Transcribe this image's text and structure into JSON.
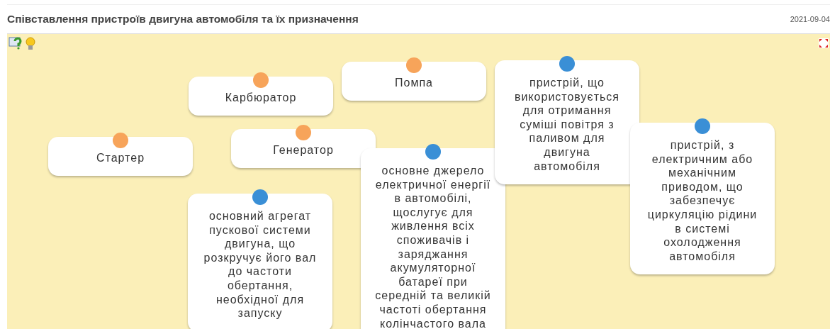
{
  "header": {
    "title": "Співставлення пристроїв двигуна автомобіля та їх призначення",
    "date": "2021-09-04"
  },
  "cards": [
    {
      "kind": "term",
      "text": "Карбюратор"
    },
    {
      "kind": "term",
      "text": "Помпа"
    },
    {
      "kind": "term",
      "text": "Стартер"
    },
    {
      "kind": "term",
      "text": "Генератор"
    },
    {
      "kind": "definition",
      "text": "основний агрегат пускової системи двигуна, що розкручує його вал до частоти обертання, необхідної для запуску"
    },
    {
      "kind": "definition",
      "text": "основне джерело електричної енергії в автомобілі, щослугує для живлення всіх споживачів і заряджання акумуляторної батареї при середній та великій частоті обертання колінчастого вала"
    },
    {
      "kind": "definition",
      "text": "пристрій, що використовується для отримання суміші повітря з паливом для двигуна автомобіля"
    },
    {
      "kind": "definition",
      "text": "пристрій, з електричним або механічним приводом, що забезпечує циркуляцію рідини в системі охолодження автомобіля"
    }
  ]
}
